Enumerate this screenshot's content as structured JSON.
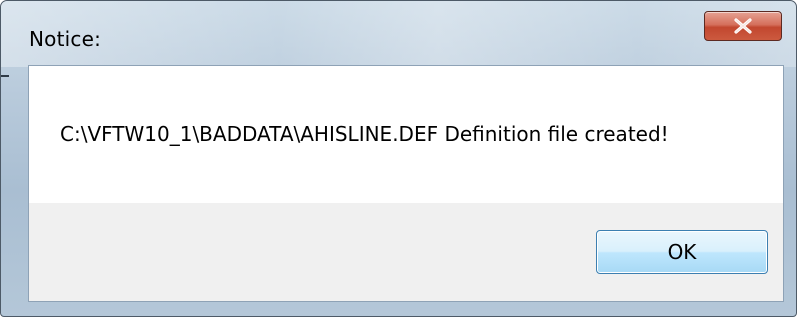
{
  "dialog": {
    "title": "Notice:",
    "message": "C:\\VFTW10_1\\BADDATA\\AHISLINE.DEF Definition file created!",
    "ok_label": "OK",
    "close_icon": "close-x-icon"
  },
  "colors": {
    "frame": "#b8cadb",
    "close_button": "#c2472f",
    "ok_button_border": "#3c7fb1",
    "content_bg": "#ffffff",
    "footer_bg": "#f0f0f0"
  }
}
